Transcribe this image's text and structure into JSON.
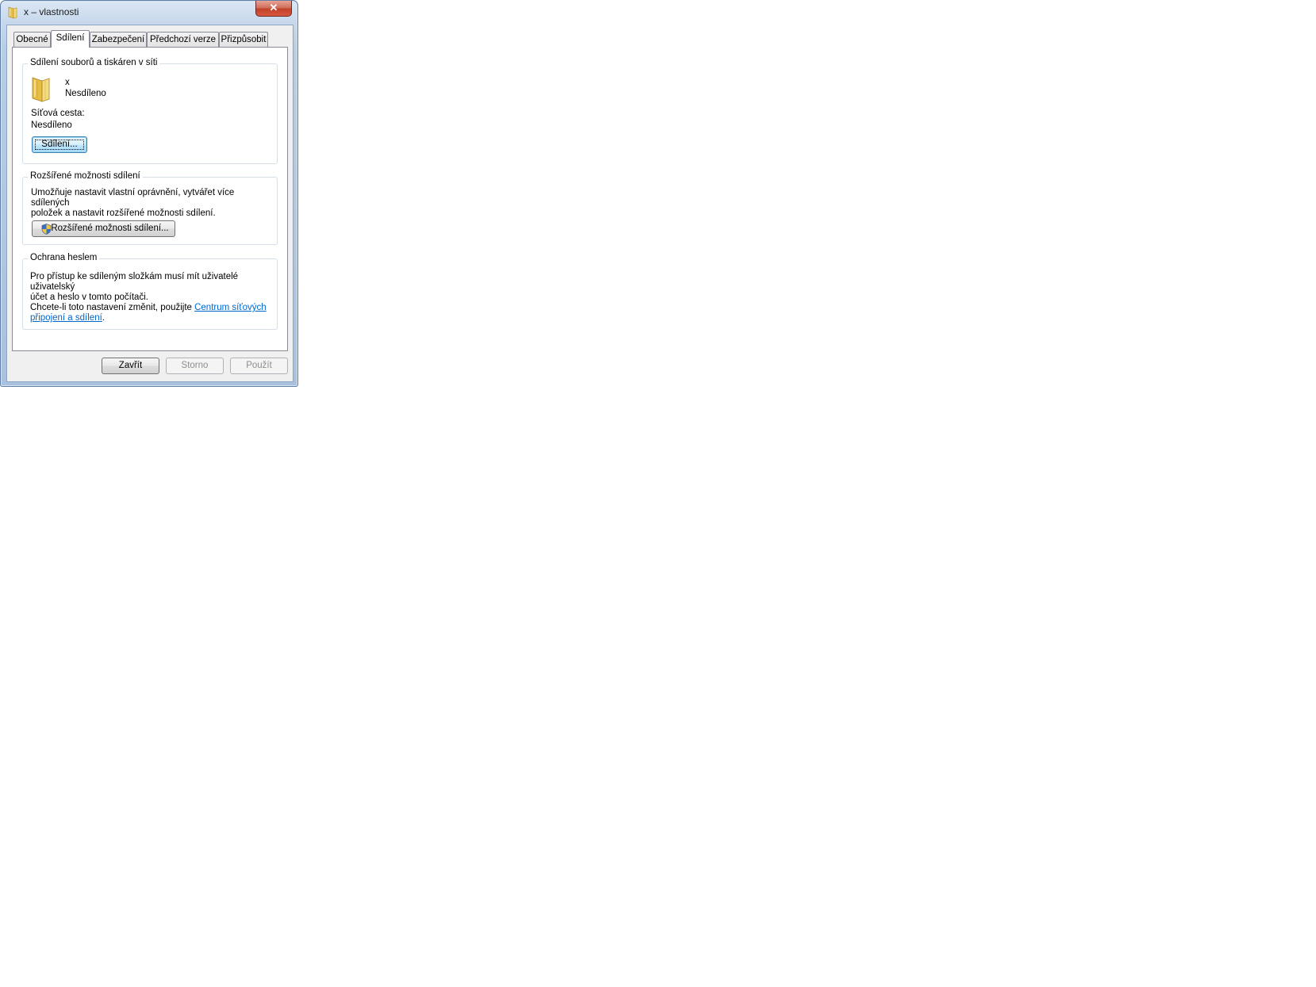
{
  "window": {
    "title": "x – vlastnosti",
    "close_label": "✕"
  },
  "tabs": [
    {
      "label": "Obecné",
      "active": false
    },
    {
      "label": "Sdílení",
      "active": true
    },
    {
      "label": "Zabezpečení",
      "active": false
    },
    {
      "label": "Předchozí verze",
      "active": false
    },
    {
      "label": "Přizpůsobit",
      "active": false
    }
  ],
  "file_sharing": {
    "title": "Sdílení souborů a tiskáren v síti",
    "folder_name": "x",
    "folder_status": "Nesdíleno",
    "network_path_label": "Síťová cesta:",
    "network_path_value": "Nesdíleno",
    "share_button": "Sdílení..."
  },
  "advanced_sharing": {
    "title": "Rozšířené možnosti sdílení",
    "description_line1": "Umožňuje nastavit vlastní oprávnění, vytvářet více sdílených",
    "description_line2": "položek a nastavit rozšířené možnosti sdílení.",
    "button": "Rozšířené možnosti sdílení..."
  },
  "password_protection": {
    "title": "Ochrana heslem",
    "text_line1": "Pro přístup ke sdíleným složkám musí mít uživatelé uživatelský",
    "text_line2": "účet a heslo v tomto počítači.",
    "change_prefix": "Chcete-li toto nastavení změnit, použijte ",
    "link_line1": "Centrum síťových",
    "link_line2": "připojení a sdílení",
    "change_suffix": "."
  },
  "footer": {
    "close_button": "Zavřít",
    "cancel_button": "Storno",
    "apply_button": "Použít"
  },
  "colors": {
    "link": "#0066cc",
    "close_button": "#c2412a",
    "disabled_text": "#8d8d8d"
  }
}
